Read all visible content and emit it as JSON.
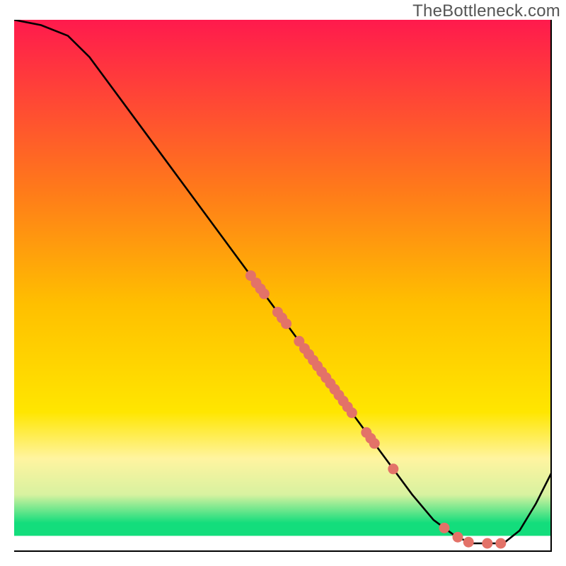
{
  "watermark": "TheBottleneck.com",
  "chart_data": {
    "type": "line",
    "title": "",
    "xlabel": "",
    "ylabel": "",
    "xlim": [
      0,
      100
    ],
    "ylim": [
      0,
      100
    ],
    "background_gradient": {
      "top": "#ff1a4d",
      "mid1": "#ffa500",
      "mid2": "#ffe600",
      "bottom": "#13dd7c",
      "white_band_top": 97,
      "white_band_bottom": 100
    },
    "curve": [
      {
        "x": 0,
        "y": 100
      },
      {
        "x": 5,
        "y": 99
      },
      {
        "x": 10,
        "y": 97
      },
      {
        "x": 14,
        "y": 93
      },
      {
        "x": 20,
        "y": 84.8
      },
      {
        "x": 30,
        "y": 71.1
      },
      {
        "x": 40,
        "y": 57.4
      },
      {
        "x": 50,
        "y": 43.7
      },
      {
        "x": 60,
        "y": 30.0
      },
      {
        "x": 68,
        "y": 19.0
      },
      {
        "x": 74,
        "y": 10.8
      },
      {
        "x": 78,
        "y": 6.0
      },
      {
        "x": 82,
        "y": 3.0
      },
      {
        "x": 85,
        "y": 1.6
      },
      {
        "x": 88,
        "y": 1.6
      },
      {
        "x": 91,
        "y": 1.6
      },
      {
        "x": 94,
        "y": 4.0
      },
      {
        "x": 97,
        "y": 9.0
      },
      {
        "x": 100,
        "y": 15.0
      }
    ],
    "points_on_curve_x": [
      44.0,
      45.0,
      45.8,
      46.5,
      49.0,
      49.8,
      50.6,
      53.0,
      54.0,
      54.8,
      55.6,
      56.4,
      57.2,
      58.0,
      58.8,
      59.6,
      60.4,
      61.2,
      62.0,
      62.8,
      65.5,
      66.3,
      67.0,
      70.5,
      80.0,
      82.5,
      84.5,
      88.0,
      90.5
    ],
    "point_style": {
      "fill": "#e37268",
      "radius": 7.5
    },
    "curve_style": {
      "stroke": "#000000",
      "width": 2.6
    },
    "border": {
      "bottom": true,
      "right": true,
      "color": "#000000",
      "width": 2
    }
  }
}
